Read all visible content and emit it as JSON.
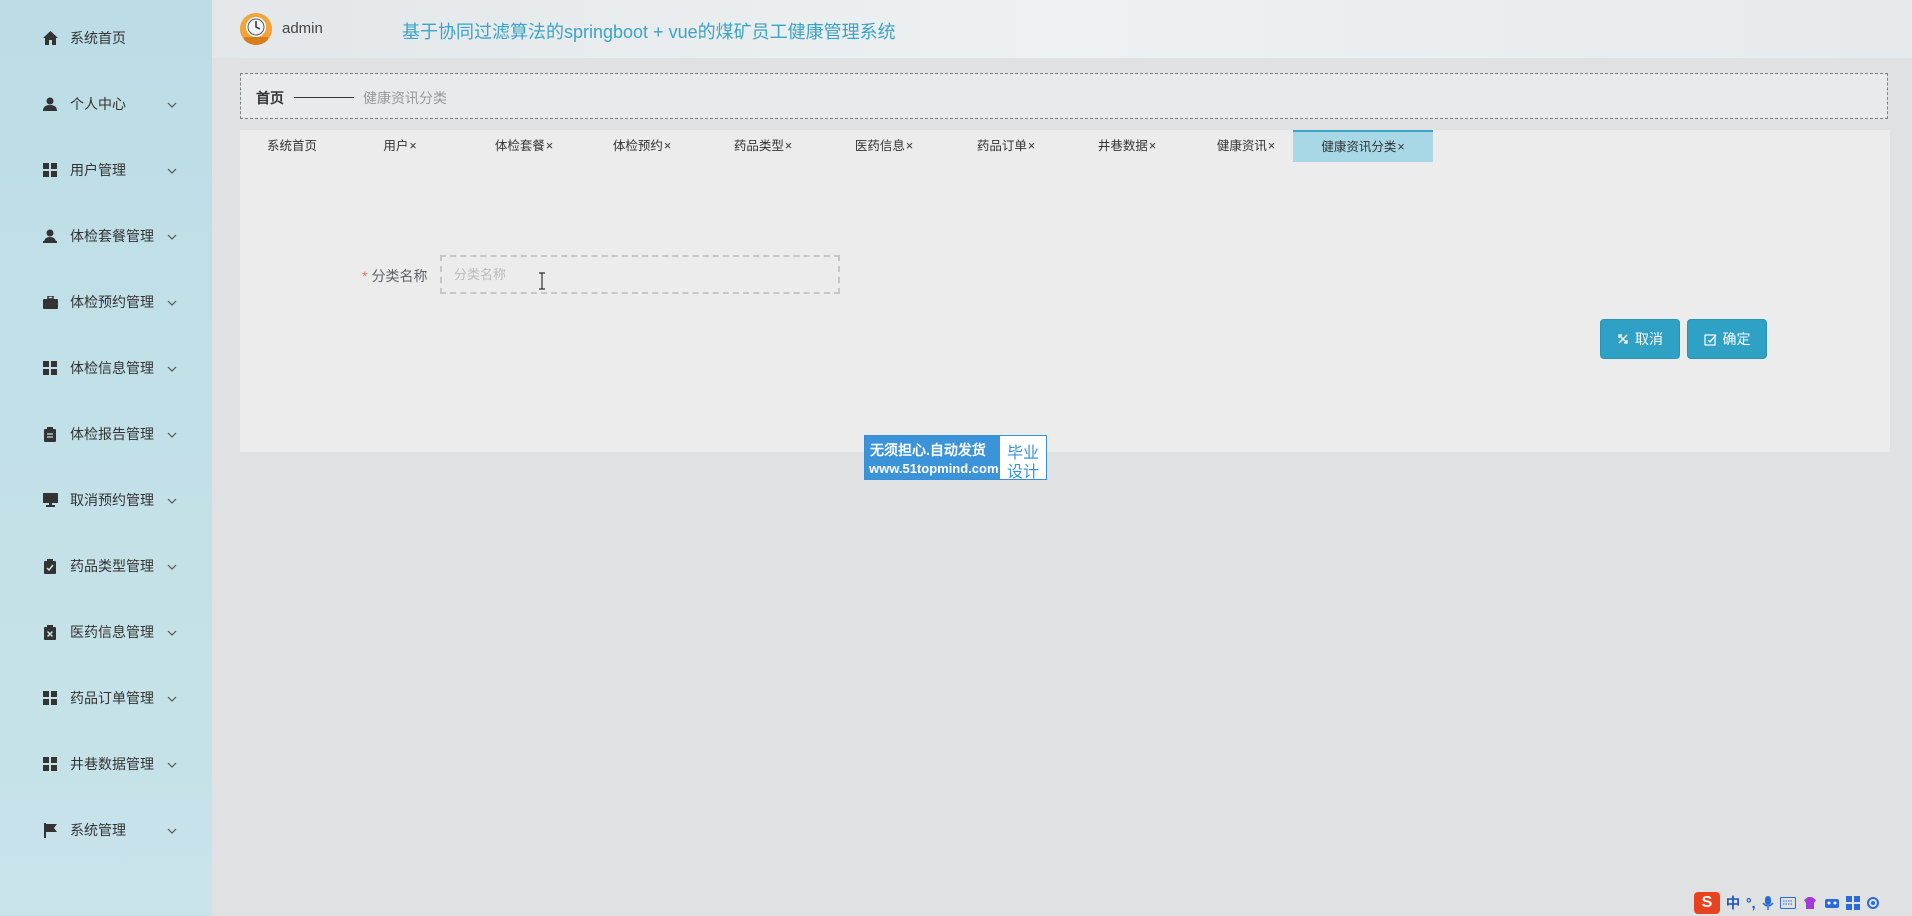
{
  "sidebar": {
    "items": [
      {
        "label": "系统首页",
        "icon": "home-icon",
        "has_children": false
      },
      {
        "label": "个人中心",
        "icon": "person-icon",
        "has_children": true
      },
      {
        "label": "用户管理",
        "icon": "grid-icon",
        "has_children": true
      },
      {
        "label": "体检套餐管理",
        "icon": "user-icon",
        "has_children": true
      },
      {
        "label": "体检预约管理",
        "icon": "briefcase-icon",
        "has_children": true
      },
      {
        "label": "体检信息管理",
        "icon": "grid-icon",
        "has_children": true
      },
      {
        "label": "体检报告管理",
        "icon": "clipboard-icon",
        "has_children": true
      },
      {
        "label": "取消预约管理",
        "icon": "monitor-icon",
        "has_children": true
      },
      {
        "label": "药品类型管理",
        "icon": "clipboard-check-icon",
        "has_children": true
      },
      {
        "label": "医药信息管理",
        "icon": "clipboard-x-icon",
        "has_children": true
      },
      {
        "label": "药品订单管理",
        "icon": "grid-icon",
        "has_children": true
      },
      {
        "label": "井巷数据管理",
        "icon": "grid-icon",
        "has_children": true
      },
      {
        "label": "系统管理",
        "icon": "flag-icon",
        "has_children": true
      }
    ]
  },
  "header": {
    "username": "admin",
    "title": "基于协同过滤算法的springboot + vue的煤矿员工健康管理系统"
  },
  "breadcrumb": {
    "home": "首页",
    "current": "健康资讯分类"
  },
  "tabs": [
    {
      "label": "系统首页",
      "closable": false,
      "active": false
    },
    {
      "label": "用户",
      "closable": true,
      "active": false
    },
    {
      "label": "体检套餐",
      "closable": true,
      "active": false
    },
    {
      "label": "体检预约",
      "closable": true,
      "active": false
    },
    {
      "label": "药品类型",
      "closable": true,
      "active": false
    },
    {
      "label": "医药信息",
      "closable": true,
      "active": false
    },
    {
      "label": "药品订单",
      "closable": true,
      "active": false
    },
    {
      "label": "井巷数据",
      "closable": true,
      "active": false
    },
    {
      "label": "健康资讯",
      "closable": true,
      "active": false
    },
    {
      "label": "健康资讯分类",
      "closable": true,
      "active": true
    }
  ],
  "tab_close_glyph": "×",
  "form": {
    "required_mark": "*",
    "category_label": "分类名称",
    "category_value": "",
    "category_placeholder": "分类名称"
  },
  "buttons": {
    "cancel": "取消",
    "confirm": "确定"
  },
  "watermark": {
    "line1": "无须担心.自动发货",
    "line2": "www.51topmind.com",
    "right1": "毕业",
    "right2": "设计"
  },
  "tray": {
    "ime_logo": "S",
    "ime_mode": "中",
    "punct": "°,"
  },
  "colors": {
    "accent": "#2ea1c4",
    "title": "#3ba3c4",
    "active_tab": "#a8d8e6",
    "sidebar": "#bcdde6"
  }
}
